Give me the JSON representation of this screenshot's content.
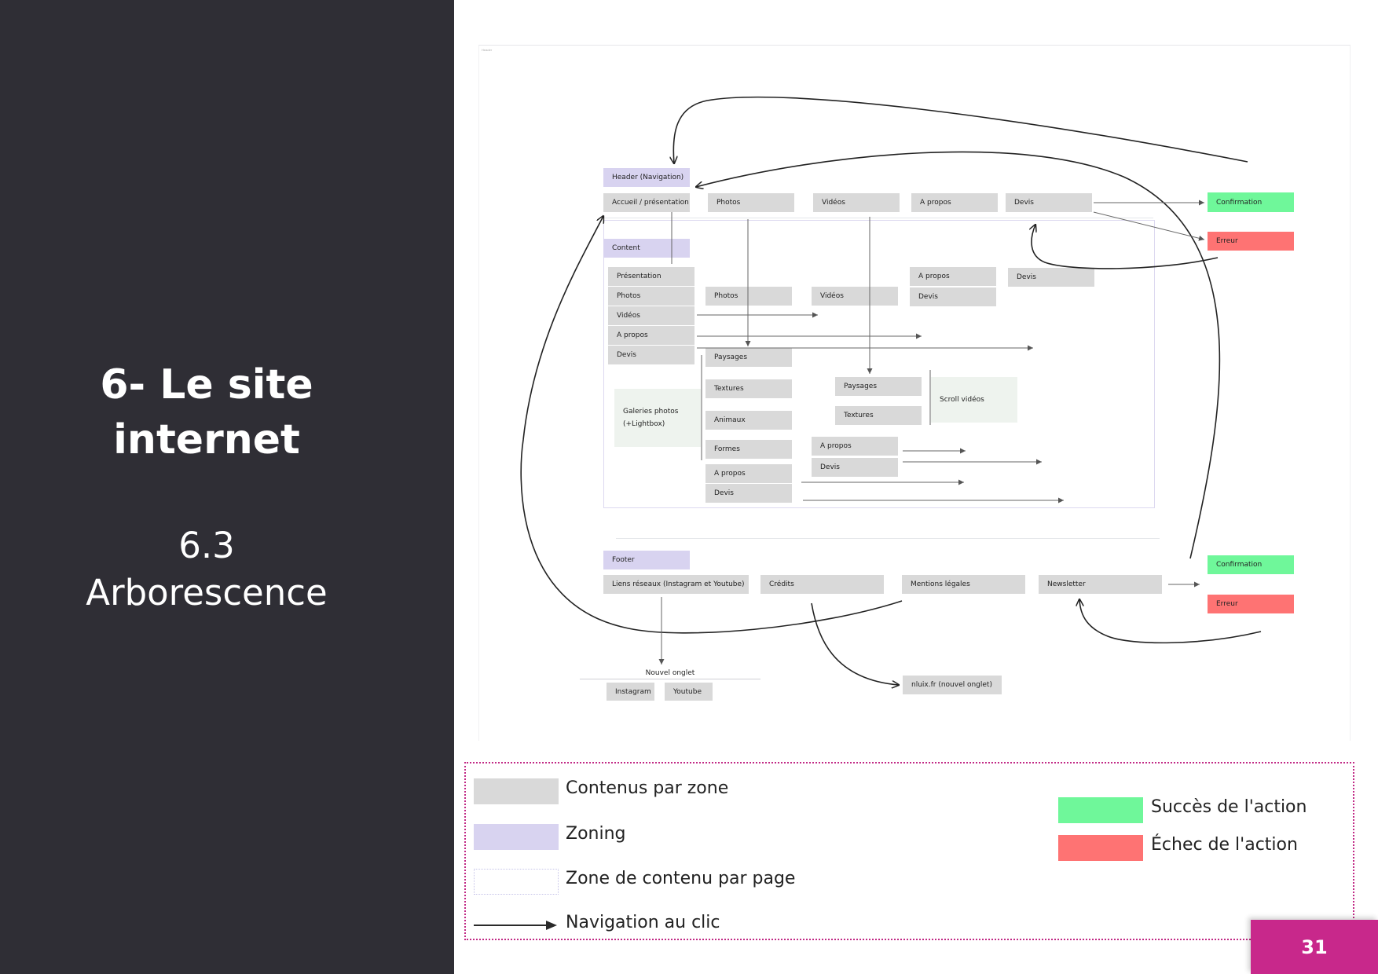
{
  "slide": {
    "title_line1": "6- Le site",
    "title_line2": "internet",
    "subtitle_line1": "6.3",
    "subtitle_line2": "Arborescence",
    "page_number": "31"
  },
  "diagram": {
    "frame_tag": "Header",
    "header": {
      "zone_label": "Header (Navigation)",
      "items": [
        "Accueil / présentation",
        "Photos",
        "Vidéos",
        "A propos",
        "Devis"
      ],
      "confirmation": "Confirmation",
      "error": "Erreur"
    },
    "content": {
      "zone_label": "Content",
      "menu": [
        "Présentation",
        "Photos",
        "Vidéos",
        "A propos",
        "Devis"
      ],
      "photos_page": {
        "title": "Photos",
        "categories": [
          "Paysages",
          "Textures",
          "Animaux",
          "Formes"
        ],
        "links": [
          "A propos",
          "Devis"
        ],
        "gallery": "Galeries photos",
        "gallery_note": "(+Lightbox)"
      },
      "videos_page": {
        "title": "Vidéos",
        "categories": [
          "Paysages",
          "Textures"
        ],
        "scroll": "Scroll vidéos",
        "links": [
          "A propos",
          "Devis"
        ]
      },
      "apropos_page": [
        "A propos",
        "Devis"
      ],
      "devis_page": "Devis"
    },
    "footer": {
      "zone_label": "Footer",
      "items": [
        "Liens réseaux (Instagram et Youtube)",
        "Crédits",
        "Mentions légales",
        "Newsletter"
      ],
      "new_tab": "Nouvel onglet",
      "socials": [
        "Instagram",
        "Youtube"
      ],
      "credits_link": "nluix.fr (nouvel onglet)",
      "confirmation": "Confirmation",
      "error": "Erreur"
    }
  },
  "legend": {
    "items": [
      "Contenus par zone",
      "Zoning",
      "Zone de contenu par page",
      "Navigation au clic"
    ],
    "success": "Succès de l'action",
    "failure": "Échec de l'action"
  },
  "colors": {
    "panel": "#2f2e35",
    "content_box": "#d9d9d9",
    "zoning": "#d8d3f0",
    "success": "#6ff79a",
    "failure": "#fe7373",
    "accent": "#c8288b"
  }
}
